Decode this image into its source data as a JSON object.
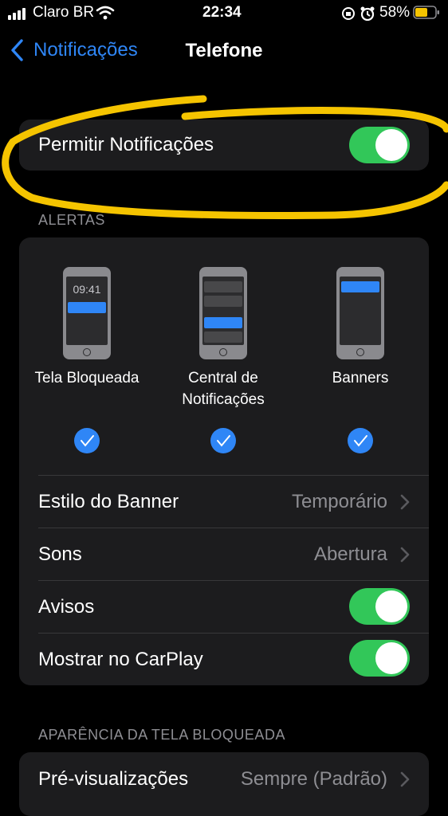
{
  "status_bar": {
    "carrier": "Claro BR",
    "time": "22:34",
    "battery": "58%"
  },
  "nav": {
    "back_label": "Notificações",
    "title": "Telefone"
  },
  "allow_notifications": {
    "label": "Permitir Notificações",
    "enabled": true
  },
  "alerts": {
    "header": "ALERTAS",
    "options": [
      {
        "label_line1": "Tela Bloqueada",
        "label_line2": "",
        "checked": true,
        "time": "09:41"
      },
      {
        "label_line1": "Central de",
        "label_line2": "Notificações",
        "checked": true
      },
      {
        "label_line1": "Banners",
        "label_line2": "",
        "checked": true
      }
    ],
    "rows": [
      {
        "label": "Estilo do Banner",
        "value": "Temporário"
      },
      {
        "label": "Sons",
        "value": "Abertura"
      },
      {
        "label": "Avisos",
        "enabled": true
      },
      {
        "label": "Mostrar no CarPlay",
        "enabled": true
      }
    ]
  },
  "lock_screen": {
    "header": "APARÊNCIA DA TELA BLOQUEADA",
    "rows": [
      {
        "label": "Pré-visualizações",
        "value": "Sempre (Padrão)"
      }
    ]
  },
  "colors": {
    "accent": "#2f86f6",
    "toggle_on": "#32c759",
    "card": "#1c1c1e",
    "highlight": "#f5c400"
  }
}
